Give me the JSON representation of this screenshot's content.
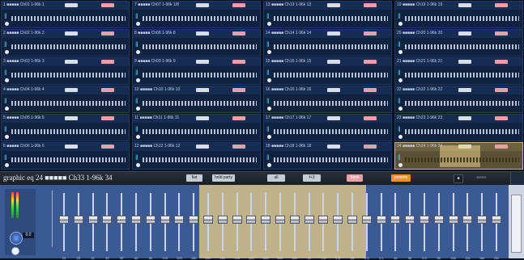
{
  "grid": {
    "cells": [
      {
        "label": "1 ■■■■■ Ch01 1-96k 1",
        "selected": false
      },
      {
        "label": "7 ■■■■■ Ch07 1-96k 1/8",
        "selected": false
      },
      {
        "label": "13 ■■■■■ Ch13 1-96k 13",
        "selected": false
      },
      {
        "label": "19 ■■■■■ Ch19 1-96k 19",
        "selected": false
      },
      {
        "label": "2 ■■■■■ Ch02 1-96k 2",
        "selected": false
      },
      {
        "label": "8 ■■■■■ Ch08 1-96k 8",
        "selected": false
      },
      {
        "label": "14 ■■■■■ Ch14 1-96k 14",
        "selected": false
      },
      {
        "label": "20 ■■■■■ Ch20 1-96k 20",
        "selected": false
      },
      {
        "label": "3 ■■■■■ Ch03 1-96k 3",
        "selected": false
      },
      {
        "label": "9 ■■■■■ Ch09 1-96k 9",
        "selected": false
      },
      {
        "label": "15 ■■■■■ Ch15 1-96k 15",
        "selected": false
      },
      {
        "label": "21 ■■■■■ Ch21 1-96k 21",
        "selected": false
      },
      {
        "label": "4 ■■■■■ Ch04 1-96k 4",
        "selected": false
      },
      {
        "label": "10 ■■■■■ Ch10 1-96k 10",
        "selected": false
      },
      {
        "label": "16 ■■■■■ Ch16 1-96k 16",
        "selected": false
      },
      {
        "label": "22 ■■■■■ Ch22 1-96k 22",
        "selected": false
      },
      {
        "label": "5 ■■■■■ Ch05 1-96k 5",
        "selected": false
      },
      {
        "label": "11 ■■■■■ Ch11 1-96k 11",
        "selected": false
      },
      {
        "label": "17 ■■■■■ Ch17 1-96k 17",
        "selected": false
      },
      {
        "label": "23 ■■■■■ Ch23 1-96k 23",
        "selected": false
      },
      {
        "label": "6 ■■■■■ Ch06 1-96k 6",
        "selected": false
      },
      {
        "label": "12 ■■■■■ Ch12 1-96k 12",
        "selected": false
      },
      {
        "label": "18 ■■■■■ Ch18 1-96k 18",
        "selected": false
      },
      {
        "label": "24 ■■■■■ Ch24 1-96k 24",
        "selected": true
      }
    ]
  },
  "bar": {
    "title": "graphic eq 24  ■■■■■ Ch33 1-96k 34",
    "buttons": [
      {
        "label": "flat",
        "style": "grey"
      },
      {
        "label": "hold party",
        "style": "grey"
      },
      {
        "label": "all",
        "style": "grey"
      },
      {
        "label": "f+3",
        "style": "grey"
      },
      {
        "label": "bank",
        "style": "pink"
      },
      {
        "label": "presets",
        "style": "orange"
      },
      {
        "label": "■",
        "style": "dark"
      }
    ],
    "dim_label": "■■■■"
  },
  "eq": {
    "knob_value": "0.0",
    "fader_labels": [
      "20",
      "25",
      "31",
      "40",
      "50",
      "63",
      "80",
      "100",
      "125",
      "160",
      "200",
      "250",
      "315",
      "400",
      "500",
      "630",
      "800",
      "1k",
      "1.2",
      "1.6",
      "2k",
      "2.5",
      "3.1",
      "4k",
      "5k",
      "6.3",
      "8k",
      "10k",
      "12k",
      "16k",
      "20k"
    ],
    "levels": [
      0.55,
      0.55,
      0.55,
      0.55,
      0.55,
      0.55,
      0.55,
      0.55,
      0.55,
      0.55,
      0.55,
      0.55,
      0.55,
      0.55,
      0.55,
      0.55,
      0.55,
      0.55,
      0.55,
      0.55,
      0.55,
      0.55,
      0.55,
      0.55,
      0.55,
      0.55,
      0.55,
      0.55,
      0.55,
      0.55,
      0.55
    ]
  }
}
